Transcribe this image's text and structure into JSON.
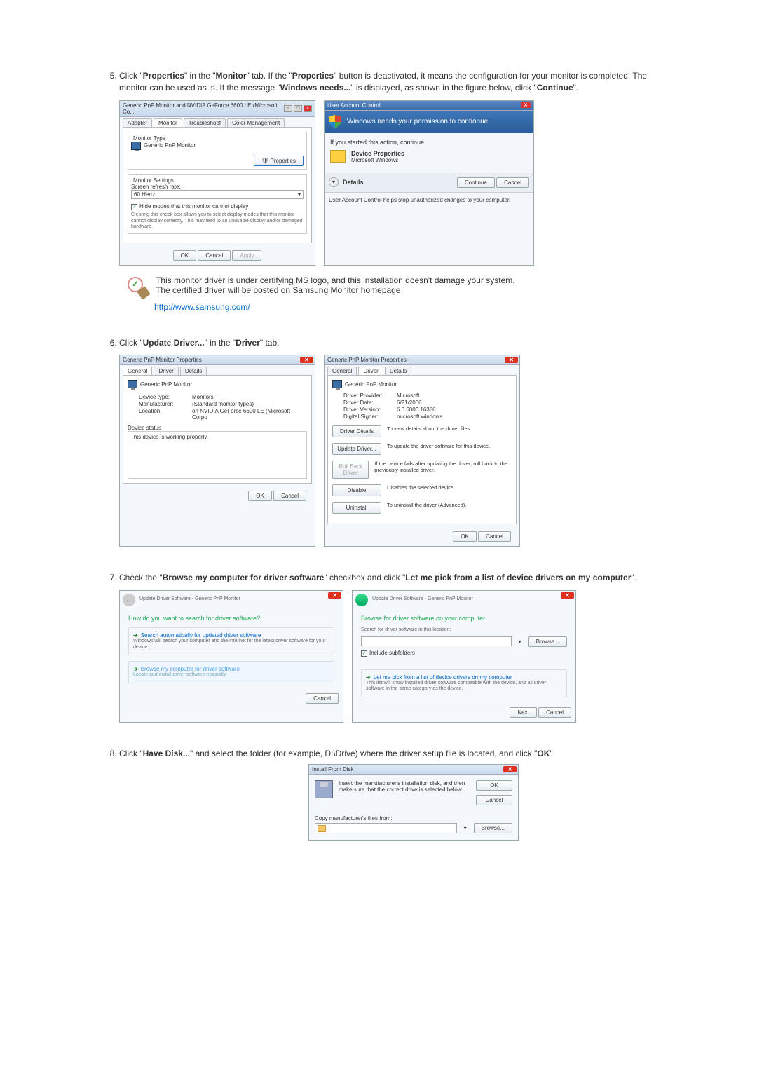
{
  "step5": {
    "num": "5.",
    "text_prefix": "Click \"",
    "properties": "Properties",
    "text_mid1": "\" in the \"",
    "monitor": "Monitor",
    "text_mid2": "\" tab. If the \"",
    "text_after_props": "\" button is deactivated, it means the configuration for your monitor is completed. The monitor can be used as is. If the message \"",
    "windows_needs": "Windows needs...",
    "text_after_needs": "\" is displayed, as shown in the figure below, click \"",
    "continue": "Continue",
    "text_end": "\".",
    "dlg1": {
      "title": "Generic PnP Monitor and NVIDIA GeForce 6600 LE (Microsoft Co...",
      "tabs": [
        "Adapter",
        "Monitor",
        "Troubleshoot",
        "Color Management"
      ],
      "monitor_type_label": "Monitor Type",
      "monitor_name": "Generic PnP Monitor",
      "btn_properties": "Properties",
      "monitor_settings_label": "Monitor Settings",
      "refresh_label": "Screen refresh rate:",
      "refresh_value": "60 Hertz",
      "hide_modes": "Hide modes that this monitor cannot display",
      "hide_modes_desc": "Clearing this check box allows you to select display modes that this monitor cannot display correctly. This may lead to an unusable display and/or damaged hardware.",
      "ok": "OK",
      "cancel": "Cancel",
      "apply": "Apply"
    },
    "uac": {
      "title": "User Account Control",
      "headline": "Windows needs your permission to contionue.",
      "if_started": "If you started this action, continue.",
      "prog_name": "Device Properties",
      "prog_pub": "Microsoft Windows",
      "details": "Details",
      "continue": "Continue",
      "cancel": "Cancel",
      "bottom_note": "User Account Control helps stop unauthorized changes to your computer."
    }
  },
  "note": {
    "line1": "This monitor driver is under certifying MS logo, and this installation doesn't damage your system.",
    "line2": "The certified driver will be posted on Samsung Monitor homepage",
    "link": "http://www.samsung.com/"
  },
  "step6": {
    "num": "6.",
    "text_prefix": "Click \"",
    "update_driver": "Update Driver...",
    "text_mid": "\" in the \"",
    "driver_tab": "Driver",
    "text_end": "\" tab.",
    "dlg1": {
      "title": "Generic PnP Monitor Properties",
      "tabs": [
        "General",
        "Driver",
        "Details"
      ],
      "monitor_name": "Generic PnP Monitor",
      "device_type_k": "Device type:",
      "device_type_v": "Monitors",
      "manufacturer_k": "Manufacturer:",
      "manufacturer_v": "(Standard monitor types)",
      "location_k": "Location:",
      "location_v": "on NVIDIA GeForce 6600 LE (Microsoft Corpo",
      "device_status_label": "Device status",
      "device_status_text": "This device is working properly.",
      "ok": "OK",
      "cancel": "Cancel"
    },
    "dlg2": {
      "title": "Generic PnP Monitor Properties",
      "tabs": [
        "General",
        "Driver",
        "Details"
      ],
      "monitor_name": "Generic PnP Monitor",
      "provider_k": "Driver Provider:",
      "provider_v": "Microsoft",
      "date_k": "Driver Date:",
      "date_v": "6/21/2006",
      "version_k": "Driver Version:",
      "version_v": "6.0.6000.16386",
      "signer_k": "Digital Signer:",
      "signer_v": "microsoft windows",
      "btn_details": "Driver Details",
      "btn_details_desc": "To view details about the driver files.",
      "btn_update": "Update Driver...",
      "btn_update_desc": "To update the driver software for this device.",
      "btn_rollback": "Roll Back Driver",
      "btn_rollback_desc": "If the device fails after updating the driver, roll back to the previously installed driver.",
      "btn_disable": "Disable",
      "btn_disable_desc": "Disables the selected device.",
      "btn_uninstall": "Uninstall",
      "btn_uninstall_desc": "To uninstall the driver (Advanced).",
      "ok": "OK",
      "cancel": "Cancel"
    }
  },
  "step7": {
    "num": "7.",
    "text_prefix": "Check the \"",
    "browse_my": "Browse my computer for driver software",
    "text_mid": "\" checkbox and click \"",
    "let_me": "Let me pick from a list of device drivers on my computer",
    "text_end": "\".",
    "wiz1": {
      "title": "Update Driver Software - Generic PnP Monitor",
      "heading": "How do you want to search for driver software?",
      "opt1_title": "Search automatically for updated driver software",
      "opt1_desc": "Windows will search your computer and the Internet for the latest driver software for your device.",
      "opt2_title": "Browse my computer for driver software",
      "opt2_desc": "Locate and install driver software manually.",
      "cancel": "Cancel"
    },
    "wiz2": {
      "title": "Update Driver Software - Generic PnP Monitor",
      "heading": "Browse for driver software on your computer",
      "search_label": "Search for driver software in this location:",
      "browse": "Browse...",
      "include_sub": "Include subfolders",
      "opt_title": "Let me pick from a list of device drivers on my computer",
      "opt_desc": "This list will show installed driver software compatible with the device, and all driver software in the same category as the device.",
      "next": "Next",
      "cancel": "Cancel"
    }
  },
  "step8": {
    "num": "8.",
    "text_prefix": "Click \"",
    "have_disk": "Have Disk...",
    "text_mid": "\" and select the folder (for example, D:\\Drive) where the driver setup file is located, and click \"",
    "ok": "OK",
    "text_end": "\".",
    "dlg": {
      "title": "Install From Disk",
      "instruction": "Insert the manufacturer's installation disk, and then make sure that the correct drive is selected below.",
      "ok": "OK",
      "cancel": "Cancel",
      "copy_label": "Copy manufacturer's files from:",
      "browse": "Browse..."
    }
  }
}
